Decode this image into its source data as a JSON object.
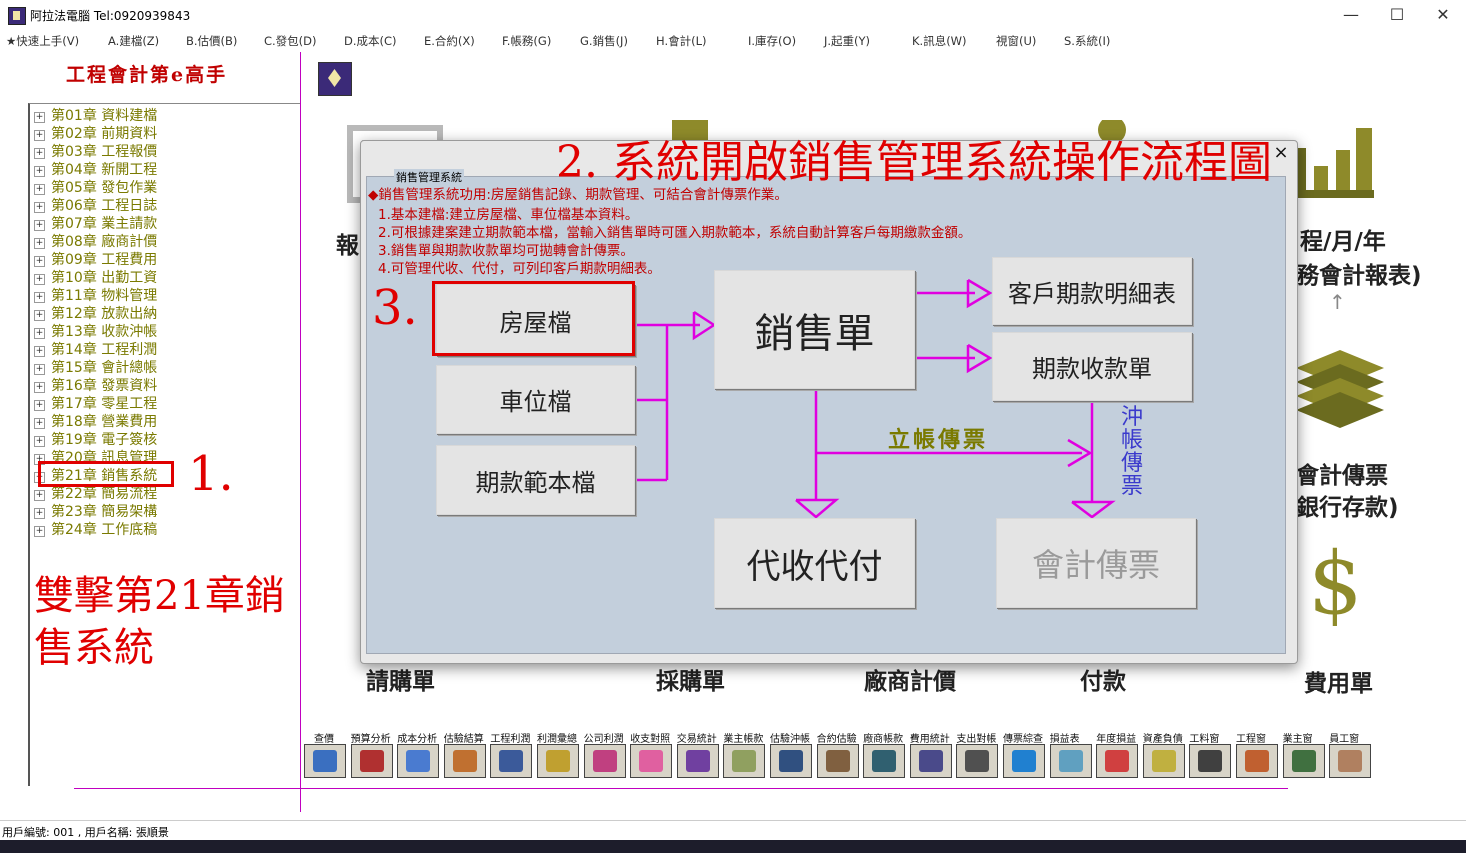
{
  "window": {
    "title": "阿拉法電腦 Tel:0920939843",
    "minimize": "—",
    "maximize": "☐",
    "close": "✕"
  },
  "menu": [
    "★快速上手(V)",
    "A.建檔(Z)",
    "B.估價(B)",
    "C.發包(D)",
    "D.成本(C)",
    "E.合約(X)",
    "F.帳務(G)",
    "G.銷售(J)",
    "H.會計(L)",
    "I.庫存(O)",
    "J.起重(Y)",
    "K.訊息(W)",
    "視窗(U)",
    "S.系統(I)"
  ],
  "sidebar": {
    "header": "工程會計第e高手",
    "chapters": [
      "第01章 資料建檔",
      "第02章 前期資料",
      "第03章 工程報價",
      "第04章 新開工程",
      "第05章 發包作業",
      "第06章 工程日誌",
      "第07章 業主請款",
      "第08章 廠商計價",
      "第09章 工程費用",
      "第10章 出勤工資",
      "第11章 物料管理",
      "第12章 放款出納",
      "第13章 收款沖帳",
      "第14章 工程利潤",
      "第15章 會計總帳",
      "第16章 發票資料",
      "第17章 零星工程",
      "第18章 營業費用",
      "第19章 電子簽核",
      "第20章 訊息管理",
      "第21章 銷售系統",
      "第22章 簡易流程",
      "第23章 簡易架構",
      "第24章 工作底稿"
    ],
    "expander": "+",
    "annotation_1": "1.",
    "instruction": "雙擊第21章銷售系統"
  },
  "background": {
    "labels": {
      "report": "報",
      "period": "程/月/年",
      "finance": "務會計報表)",
      "voucher": "會計傳票",
      "deposit": "銀行存款)",
      "purchase_req": "請購單",
      "purchase": "採購單",
      "vendor_pricing": "廠商計價",
      "payment": "付款",
      "expense": "費用單"
    },
    "arrow_up": "↑",
    "dollar": "$"
  },
  "dialog": {
    "group_label": "銷售管理系統",
    "close": "×",
    "annotation_2": "2. 系統開啟銷售管理系統操作流程圖",
    "annotation_3": "3.",
    "desc_lines": [
      "◆銷售管理系統功用:房屋銷售記錄、期款管理、可結合會計傳票作業。",
      "1.基本建檔:建立房屋檔、車位檔基本資料。",
      "2.可根據建案建立期款範本檔，當輸入銷售單時可匯入期款範本，系統自動計算客戶每期繳款金額。",
      "3.銷售單與期款收款單均可拋轉會計傳票。",
      "4.可管理代收、代付，可列印客戶期款明細表。"
    ],
    "buttons": {
      "house": "房屋檔",
      "parking": "車位檔",
      "template": "期款範本檔",
      "sales": "銷售單",
      "customer_detail": "客戶期款明細表",
      "receipt": "期款收款單",
      "collect": "代收代付",
      "voucher": "會計傳票"
    },
    "label_post": "立帳傳票",
    "label_offset": "沖帳傳票"
  },
  "toolbar": {
    "labels": [
      "查價",
      "預算分析",
      "成本分析",
      "估驗結算",
      "工程利潤",
      "利潤彙總",
      "公司利潤",
      "收支對照",
      "交易統計",
      "業主帳款",
      "估驗沖帳",
      "合約估驗",
      "廠商帳款",
      "費用統計",
      "支出對帳",
      "傳票綜查",
      "損益表",
      "年度損益",
      "資產負債",
      "工料窗",
      "工程窗",
      "業主窗",
      "員工窗"
    ]
  },
  "status": {
    "text": "用戶編號: 001 , 用戶名稱: 張順景"
  },
  "colors": {
    "accent_red": "#e00000",
    "magenta": "#e000e0",
    "olive": "#7a7a00",
    "dialog_bg": "#c3cfdc"
  }
}
